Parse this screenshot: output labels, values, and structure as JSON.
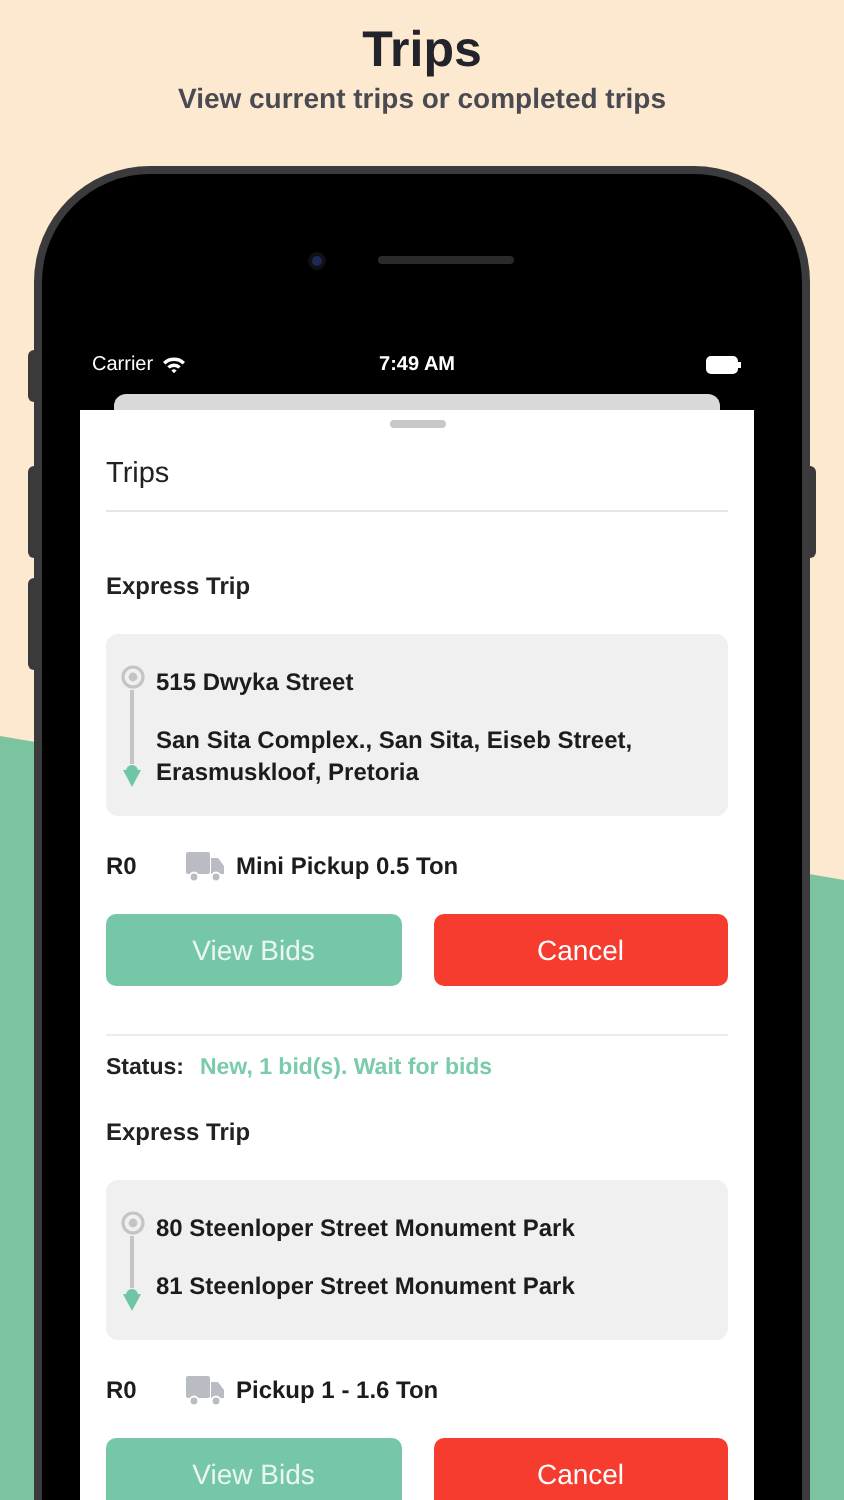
{
  "header": {
    "title": "Trips",
    "subtitle": "View current trips or completed trips"
  },
  "status_bar": {
    "carrier": "Carrier",
    "time": "7:49 AM"
  },
  "sheet": {
    "title": "Trips"
  },
  "trips": [
    {
      "type": "Express Trip",
      "pickup": "515 Dwyka Street",
      "dropoff": "San Sita Complex., San Sita, Eiseb Street, Erasmuskloof, Pretoria",
      "price": "R0",
      "vehicle": "Mini Pickup 0.5 Ton",
      "buttons": [
        {
          "kind": "primary",
          "label": "View Bids"
        },
        {
          "kind": "danger",
          "label": "Cancel"
        }
      ]
    },
    {
      "status": {
        "label": "Status:",
        "value": "New, 1 bid(s). Wait for bids"
      },
      "type": "Express Trip",
      "pickup": "80 Steenloper Street Monument Park",
      "dropoff": "81 Steenloper Street Monument Park",
      "price": "R0",
      "vehicle": "Pickup 1 - 1.6 Ton",
      "buttons": [
        {
          "kind": "primary",
          "label": "View Bids"
        },
        {
          "kind": "danger",
          "label": "Cancel"
        }
      ]
    }
  ]
}
